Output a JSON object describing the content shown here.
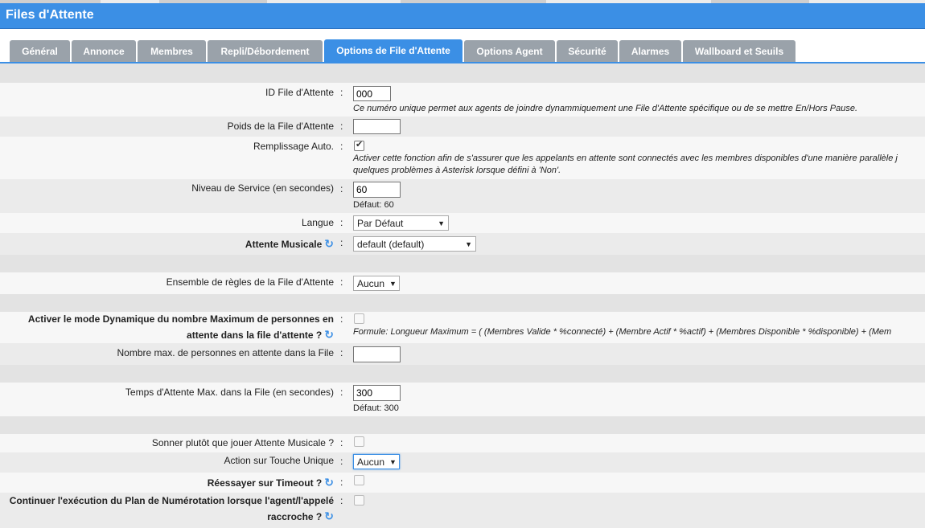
{
  "window_title": "Files d'Attente",
  "tabs": [
    {
      "label": "Général",
      "active": false
    },
    {
      "label": "Annonce",
      "active": false
    },
    {
      "label": "Membres",
      "active": false
    },
    {
      "label": "Repli/Débordement",
      "active": false
    },
    {
      "label": "Options de File d'Attente",
      "active": true
    },
    {
      "label": "Options Agent",
      "active": false
    },
    {
      "label": "Sécurité",
      "active": false
    },
    {
      "label": "Alarmes",
      "active": false
    },
    {
      "label": "Wallboard et Seuils",
      "active": false
    }
  ],
  "fields": {
    "queue_id": {
      "label": "ID File d'Attente",
      "value": "000",
      "hint": "Ce numéro unique permet aux agents de joindre dynammiquement une File d'Attente spécifique ou de se mettre En/Hors Pause."
    },
    "queue_weight": {
      "label": "Poids de la File d'Attente",
      "value": ""
    },
    "autofill": {
      "label": "Remplissage Auto.",
      "checked": true,
      "hint_line1": "Activer cette fonction afin de s'assurer que les appelants en attente sont connectés avec les membres disponibles d'une manière parallèle j",
      "hint_line2": "quelques problèmes à Asterisk lorsque défini à 'Non'."
    },
    "service_level": {
      "label": "Niveau de Service (en secondes)",
      "value": "60",
      "default": "Défaut: 60"
    },
    "language": {
      "label": "Langue",
      "selected": "Par Défaut"
    },
    "music_on_hold": {
      "label": "Attente Musicale",
      "selected": "default (default)"
    },
    "ruleset": {
      "label": "Ensemble de règles de la File d'Attente",
      "selected": "Aucun"
    },
    "dynamic_max": {
      "label_line1": "Activer le mode Dynamique du nombre Maximum de personnes en",
      "label_line2": "attente dans la file d'attente ?",
      "checked": false,
      "hint": "Formule: Longueur Maximum = ( (Membres Valide * %connecté) + (Membre Actif * %actif) + (Membres Disponible * %disponible) + (Mem"
    },
    "max_callers": {
      "label": "Nombre max. de personnes en attente dans la File",
      "value": ""
    },
    "max_wait": {
      "label": "Temps d'Attente Max. dans la File (en secondes)",
      "value": "300",
      "default": "Défaut: 300"
    },
    "ring_instead_moh": {
      "label": "Sonner plutôt que jouer Attente Musicale ?",
      "checked": false
    },
    "single_key_action": {
      "label": "Action sur Touche Unique",
      "selected": "Aucun"
    },
    "retry_timeout": {
      "label": "Réessayer sur Timeout ?",
      "checked": false
    },
    "continue_dialplan": {
      "label_line1": "Continuer l'exécution du Plan de Numérotation lorsque l'agent/l'appelé",
      "label_line2": "raccroche ?",
      "checked": false
    }
  },
  "colon": ":",
  "icons": {
    "refresh": "refresh-icon",
    "dropdown": "chevron-down-icon",
    "checkbox_check": "check-icon"
  },
  "colors": {
    "accent": "#3b8fe5",
    "tab_inactive": "#9aa2aa"
  }
}
